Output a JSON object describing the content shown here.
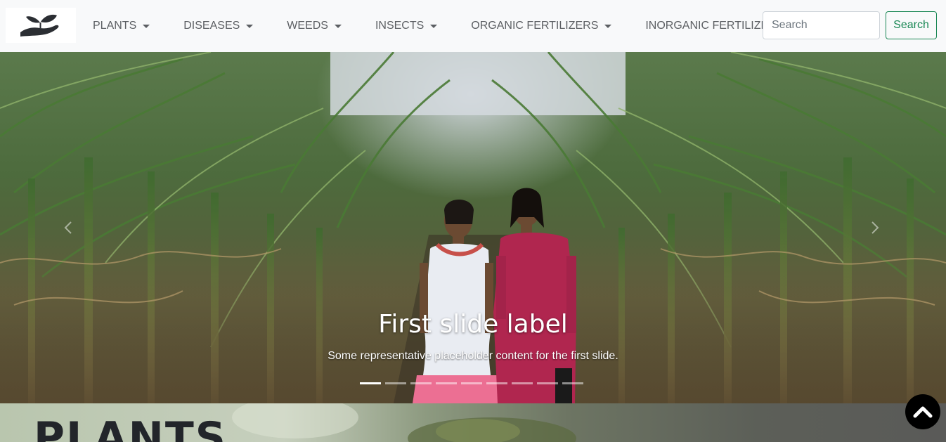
{
  "navbar": {
    "logo_icon": "plant-in-hand-icon",
    "items": [
      {
        "label": "PLANTS"
      },
      {
        "label": "DISEASES"
      },
      {
        "label": "WEEDS"
      },
      {
        "label": "INSECTS"
      },
      {
        "label": "ORGANIC FERTILIZERS"
      },
      {
        "label": "INORGANIC FERTILIZERS"
      }
    ],
    "search": {
      "placeholder": "Search",
      "value": ""
    },
    "search_button": "Search",
    "colors": {
      "background": "#f8f9fa",
      "search_button": "#198754"
    }
  },
  "carousel": {
    "title": "First slide label",
    "text": "Some representative placeholder content for the first slide.",
    "slide_count": 9,
    "active_index": 0,
    "prev_icon": "chevron-left-icon",
    "next_icon": "chevron-right-icon"
  },
  "section": {
    "title": "PLANTS"
  },
  "back_to_top": {
    "icon": "chevron-up-icon",
    "color": "#000000"
  }
}
